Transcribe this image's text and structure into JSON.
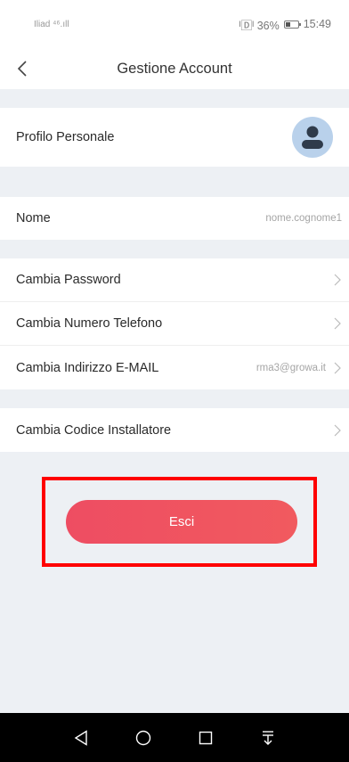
{
  "status_bar": {
    "carrier": "Iliad ⁴⁶.ıll",
    "battery_text": "ᴵ🄳ᴵ 36%",
    "time": "15:49"
  },
  "header": {
    "title": "Gestione Account",
    "back_icon": "chevron-left-icon"
  },
  "profile": {
    "label": "Profilo Personale",
    "avatar_icon": "user-avatar-icon"
  },
  "fields": {
    "name": {
      "label": "Nome",
      "value": "nome.cognome1"
    }
  },
  "menu": [
    {
      "label": "Cambia Password",
      "value": ""
    },
    {
      "label": "Cambia Numero Telefono",
      "value": ""
    },
    {
      "label": "Cambia Indirizzo E-MAIL",
      "value": "rma3@growa.it"
    },
    {
      "label": "Cambia Codice Installatore",
      "value": ""
    }
  ],
  "logout": {
    "label": "Esci"
  },
  "colors": {
    "background": "#edf0f4",
    "button_gradient_start": "#ee4d62",
    "button_gradient_end": "#f15a5f",
    "highlight": "#ff0000",
    "avatar_bg": "#b9d1eb"
  },
  "system_nav": [
    "back-triangle-icon",
    "home-circle-icon",
    "recents-square-icon",
    "notifications-down-icon"
  ]
}
